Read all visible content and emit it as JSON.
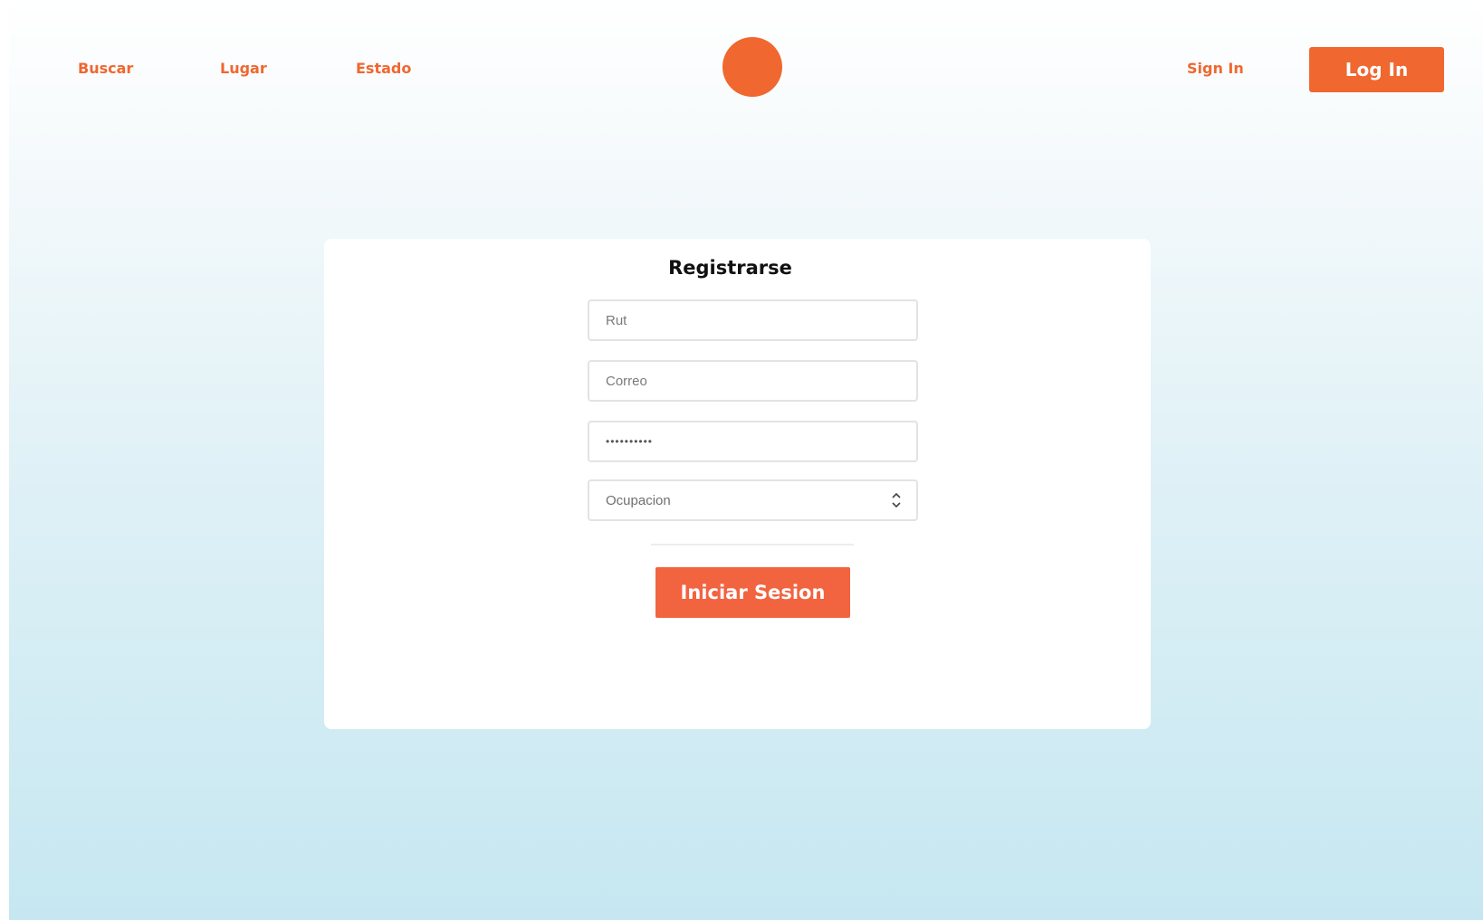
{
  "header": {
    "nav": {
      "search_label": "Buscar",
      "place_label": "Lugar",
      "status_label": "Estado"
    },
    "logo_icon": "circle-logo",
    "signin_label": "Sign In",
    "login_label": "Log In"
  },
  "form": {
    "title": "Registrarse",
    "rut_placeholder": "Rut",
    "email_placeholder": "Correo",
    "password_value": "••••••••••",
    "occupation_value": "Ocupacion",
    "submit_label": "Iniciar Sesion"
  },
  "colors": {
    "accent": "#f0672f",
    "button": "#f26340",
    "background_top": "#ffffff",
    "background_bottom": "#c6e7f1"
  }
}
